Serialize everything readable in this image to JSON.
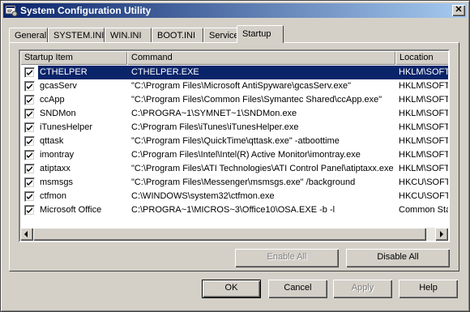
{
  "window": {
    "title": "System Configuration Utility",
    "close_label": "✕"
  },
  "tabs": [
    {
      "label": "General",
      "active": false
    },
    {
      "label": "SYSTEM.INI",
      "active": false
    },
    {
      "label": "WIN.INI",
      "active": false
    },
    {
      "label": "BOOT.INI",
      "active": false
    },
    {
      "label": "Services",
      "active": false
    },
    {
      "label": "Startup",
      "active": true
    }
  ],
  "list": {
    "columns": [
      "Startup Item",
      "Command",
      "Location"
    ],
    "rows": [
      {
        "checked": true,
        "selected": true,
        "item": "CTHELPER",
        "command": "CTHELPER.EXE",
        "location": "HKLM\\SOFTWARE"
      },
      {
        "checked": true,
        "selected": false,
        "item": "gcasServ",
        "command": "\"C:\\Program Files\\Microsoft AntiSpyware\\gcasServ.exe\"",
        "location": "HKLM\\SOFTWARE"
      },
      {
        "checked": true,
        "selected": false,
        "item": "ccApp",
        "command": "\"C:\\Program Files\\Common Files\\Symantec Shared\\ccApp.exe\"",
        "location": "HKLM\\SOFTWARE"
      },
      {
        "checked": true,
        "selected": false,
        "item": "SNDMon",
        "command": "C:\\PROGRA~1\\SYMNET~1\\SNDMon.exe",
        "location": "HKLM\\SOFTWARE"
      },
      {
        "checked": true,
        "selected": false,
        "item": "iTunesHelper",
        "command": "C:\\Program Files\\iTunes\\iTunesHelper.exe",
        "location": "HKLM\\SOFTWARE"
      },
      {
        "checked": true,
        "selected": false,
        "item": "qttask",
        "command": "\"C:\\Program Files\\QuickTime\\qttask.exe\" -atboottime",
        "location": "HKLM\\SOFTWARE"
      },
      {
        "checked": true,
        "selected": false,
        "item": "imontray",
        "command": "C:\\Program Files\\Intel\\Intel(R) Active Monitor\\imontray.exe",
        "location": "HKLM\\SOFTWARE"
      },
      {
        "checked": true,
        "selected": false,
        "item": "atiptaxx",
        "command": "\"C:\\Program Files\\ATI Technologies\\ATI Control Panel\\atiptaxx.exe",
        "location": "HKLM\\SOFTWARE"
      },
      {
        "checked": true,
        "selected": false,
        "item": "msmsgs",
        "command": "\"C:\\Program Files\\Messenger\\msmsgs.exe\" /background",
        "location": "HKCU\\SOFTWARE"
      },
      {
        "checked": true,
        "selected": false,
        "item": "ctfmon",
        "command": "C:\\WINDOWS\\system32\\ctfmon.exe",
        "location": "HKCU\\SOFTWARE"
      },
      {
        "checked": true,
        "selected": false,
        "item": "Microsoft Office",
        "command": "C:\\PROGRA~1\\MICROS~3\\Office10\\OSA.EXE -b -l",
        "location": "Common Startup"
      }
    ]
  },
  "buttons": {
    "enable_all": "Enable All",
    "disable_all": "Disable All",
    "ok": "OK",
    "cancel": "Cancel",
    "apply": "Apply",
    "help": "Help"
  },
  "colors": {
    "titlebar_start": "#0a246a",
    "titlebar_end": "#a6caf0",
    "selection": "#0a246a",
    "face": "#d4d0c8"
  }
}
